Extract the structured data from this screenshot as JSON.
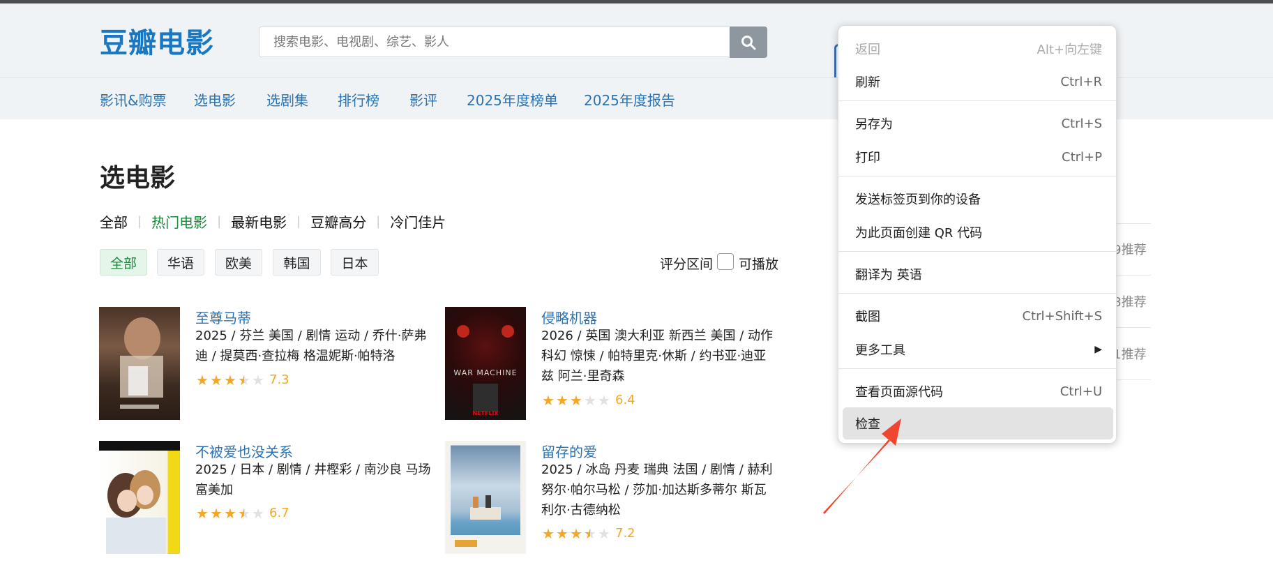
{
  "header": {
    "logo_text": "豆瓣电影",
    "search_placeholder": "搜索电影、电视剧、综艺、影人",
    "search_icon": "search-icon"
  },
  "nav": {
    "items": [
      "影讯&购票",
      "选电影",
      "选剧集",
      "排行榜",
      "影评",
      "2025年度榜单",
      "2025年度报告"
    ]
  },
  "main": {
    "title": "选电影",
    "type_tags": [
      {
        "label": "全部",
        "active": false
      },
      {
        "label": "热门电影",
        "active": true
      },
      {
        "label": "最新电影",
        "active": false
      },
      {
        "label": "豆瓣高分",
        "active": false
      },
      {
        "label": "冷门佳片",
        "active": false
      }
    ],
    "region_chips": [
      {
        "label": "全部",
        "active": true
      },
      {
        "label": "华语",
        "active": false
      },
      {
        "label": "欧美",
        "active": false
      },
      {
        "label": "韩国",
        "active": false
      },
      {
        "label": "日本",
        "active": false
      }
    ],
    "score_range_label": "评分区间",
    "playable_label": "可播放",
    "movies": [
      {
        "title": "至尊马蒂",
        "meta": "2025 / 芬兰 美国 / 剧情 运动 / 乔什·萨弗迪 / 提莫西·查拉梅 格温妮斯·帕特洛",
        "stars": 3.5,
        "score": "7.3"
      },
      {
        "title": "侵略机器",
        "meta": "2026 / 英国 澳大利亚 新西兰 美国 / 动作 科幻 惊悚 / 帕特里克·休斯 / 约书亚·迪亚兹 阿兰·里奇森",
        "stars": 3,
        "score": "6.4"
      },
      {
        "title": "不被爱也没关系",
        "meta": "2025 / 日本 / 剧情 / 井樫彩 / 南沙良 马场富美加",
        "stars": 3.5,
        "score": "6.7"
      },
      {
        "title": "留存的爱",
        "meta": "2025 / 冰岛 丹麦 瑞典 法国 / 剧情 / 赫利努尔·帕尔马松 / 莎加·加达斯多蒂尔 斯瓦利尔·古德纳松",
        "stars": 3.5,
        "score": "7.2"
      }
    ],
    "poster_texts": {
      "war_machine": "WAR MACHINE",
      "netflix": "NETFLIX"
    }
  },
  "sidebar": {
    "recommend_counts": [
      "9推荐",
      "8推荐",
      "1推荐"
    ]
  },
  "context_menu": {
    "items": [
      {
        "label": "返回",
        "shortcut": "Alt+向左键",
        "disabled": true
      },
      {
        "label": "刷新",
        "shortcut": "Ctrl+R"
      },
      {
        "label": "另存为",
        "shortcut": "Ctrl+S"
      },
      {
        "label": "打印",
        "shortcut": "Ctrl+P"
      },
      {
        "label": "发送标签页到你的设备",
        "shortcut": ""
      },
      {
        "label": "为此页面创建 QR 代码",
        "shortcut": ""
      },
      {
        "label": "翻译为 英语",
        "shortcut": ""
      },
      {
        "label": "截图",
        "shortcut": "Ctrl+Shift+S"
      },
      {
        "label": "更多工具",
        "shortcut": "▶"
      },
      {
        "label": "查看页面源代码",
        "shortcut": "Ctrl+U"
      },
      {
        "label": "检查",
        "shortcut": "",
        "highlighted": true
      }
    ]
  },
  "colors": {
    "brand_blue": "#1a78c2",
    "link_blue": "#2c73b3",
    "active_green": "#1a8a3a",
    "star_orange": "#f5a623",
    "arrow_red": "#f0452e"
  }
}
